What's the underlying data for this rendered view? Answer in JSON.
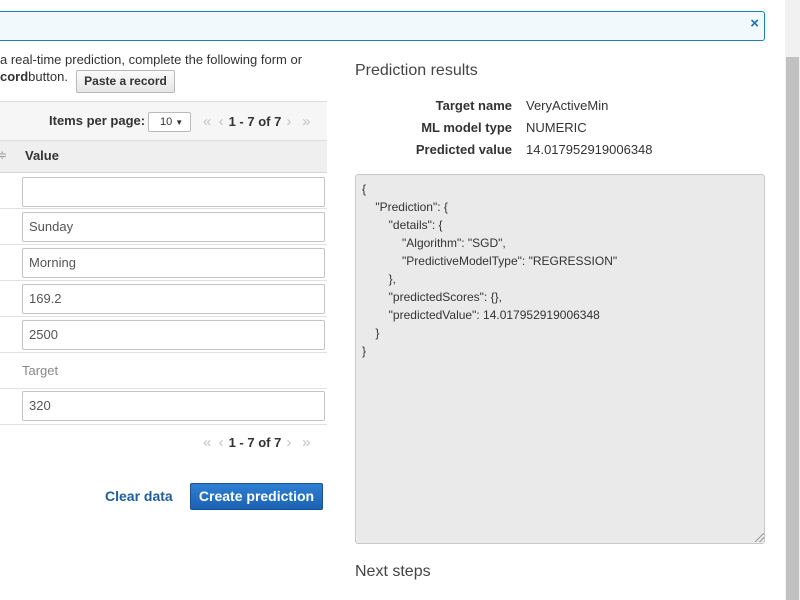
{
  "info_bar": {
    "close_symbol": "×"
  },
  "intro": {
    "line1": "a real-time prediction, complete the following form or",
    "line2_bold": "cord",
    "line2_rest": " button.",
    "paste_button": "Paste a record"
  },
  "table": {
    "items_per_page_label": "Items per page:",
    "items_per_page_value": "10",
    "pager": {
      "first": "«",
      "prev": "‹",
      "range": "1 - 7 of 7",
      "next": "›",
      "last": "»"
    },
    "sort_symbol": "≑",
    "value_header": "Value",
    "rows": [
      "",
      "Sunday",
      "Morning",
      "169.2",
      "2500",
      "Target",
      "320"
    ]
  },
  "actions": {
    "clear": "Clear data",
    "create": "Create prediction"
  },
  "results": {
    "title": "Prediction results",
    "target_name_label": "Target name",
    "target_name_value": "VeryActiveMin",
    "model_type_label": "ML model type",
    "model_type_value": "NUMERIC",
    "predicted_label": "Predicted value",
    "predicted_value": "14.017952919006348",
    "json": "{\n    \"Prediction\": {\n        \"details\": {\n            \"Algorithm\": \"SGD\",\n            \"PredictiveModelType\": \"REGRESSION\"\n        },\n        \"predictedScores\": {},\n        \"predictedValue\": 14.017952919006348\n    }\n}"
  },
  "next_steps": "Next steps",
  "colors": {
    "primary": "#1c62b3",
    "link": "#1f5e9e",
    "info_border": "#1f7fb6"
  }
}
